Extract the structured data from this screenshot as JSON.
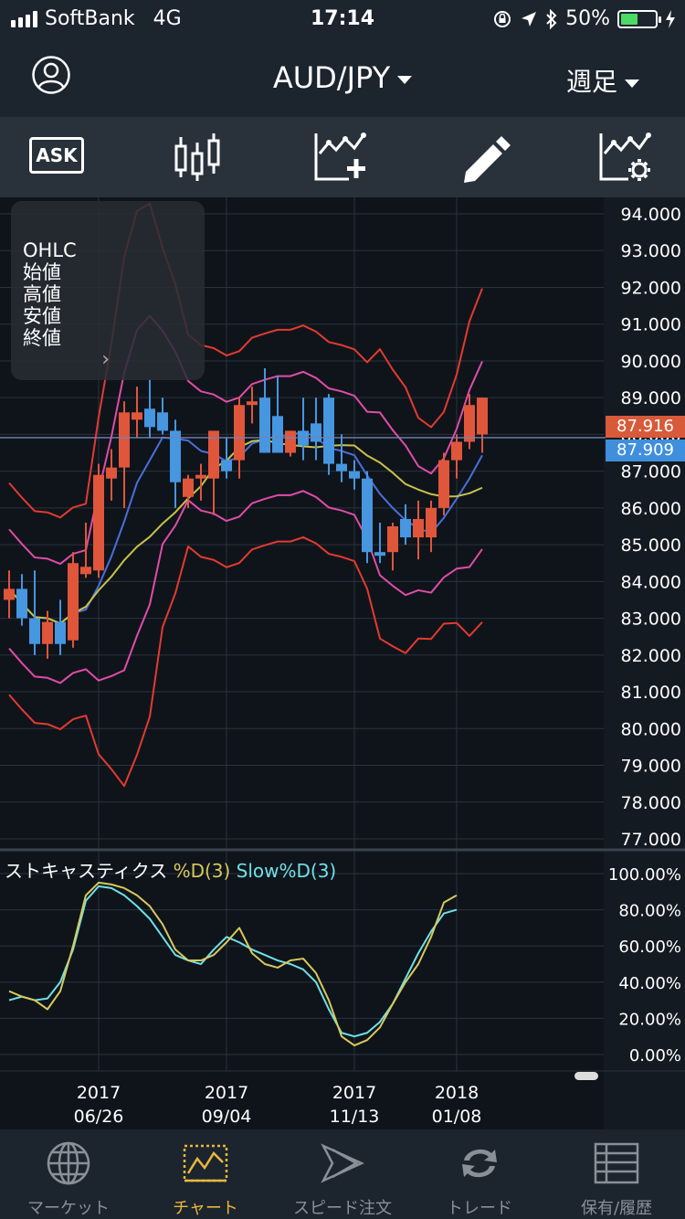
{
  "status_bar": {
    "carrier": "SoftBank",
    "network": "4G",
    "time": "17:14",
    "battery": "50%",
    "battery_level": 0.5
  },
  "nav": {
    "pair": "AUD/JPY",
    "period": "週足"
  },
  "toolbar": {
    "ask_label": "ASK"
  },
  "ohlc_panel": {
    "title": "OHLC",
    "open": "始値",
    "high": "高値",
    "low": "安値",
    "close": "終値"
  },
  "price_tags": {
    "ask": "87.916",
    "bid": "87.909"
  },
  "indicator": {
    "name": "ストキャスティクス",
    "k_label": "%D(3)",
    "slow_label": "Slow%D(3)"
  },
  "colors": {
    "up": "#e0563b",
    "down": "#4696e0",
    "ma_short": "#4a6fdc",
    "ma_long": "#c8c24a",
    "band_inner": "#e04ca8",
    "band_outer": "#e43a2f",
    "k_line": "#d8c95a",
    "slow_line": "#6fe0e8",
    "active_tab": "#e9b83c"
  },
  "chart_data": {
    "type": "candlestick",
    "price_axis": {
      "ticks": [
        "94.000",
        "93.000",
        "92.000",
        "91.000",
        "90.000",
        "89.000",
        "88.000",
        "87.000",
        "86.000",
        "85.000",
        "84.000",
        "83.000",
        "82.000",
        "81.000",
        "80.000",
        "79.000",
        "78.000",
        "77.000"
      ],
      "ylim": [
        77,
        94
      ]
    },
    "osc_axis": {
      "ticks": [
        "100.00%",
        "80.00%",
        "60.00%",
        "40.00%",
        "20.00%",
        "0.00%"
      ],
      "ylim": [
        0,
        100
      ]
    },
    "date_labels": [
      {
        "year": "2017",
        "date": "06/26"
      },
      {
        "year": "2017",
        "date": "09/04"
      },
      {
        "year": "2017",
        "date": "11/13"
      },
      {
        "year": "2018",
        "date": "01/08"
      }
    ],
    "date_label_index": [
      7,
      17,
      27,
      35
    ],
    "candles": [
      [
        83.5,
        84.3,
        83.0,
        83.8
      ],
      [
        83.8,
        84.2,
        82.8,
        83.0
      ],
      [
        83.0,
        84.3,
        82.0,
        82.3
      ],
      [
        82.3,
        83.2,
        81.9,
        82.9
      ],
      [
        82.9,
        83.5,
        82.0,
        82.3
      ],
      [
        82.4,
        84.8,
        82.2,
        84.5
      ],
      [
        84.2,
        85.6,
        84.1,
        84.4
      ],
      [
        84.3,
        87.2,
        84.1,
        86.9
      ],
      [
        86.8,
        87.6,
        86.2,
        87.1
      ],
      [
        87.1,
        88.9,
        86.0,
        88.6
      ],
      [
        88.4,
        89.3,
        87.9,
        88.6
      ],
      [
        88.7,
        89.5,
        87.9,
        88.2
      ],
      [
        88.6,
        89.0,
        88.0,
        88.1
      ],
      [
        88.1,
        88.4,
        86.0,
        86.7
      ],
      [
        86.3,
        86.9,
        86.0,
        86.8
      ],
      [
        86.8,
        87.2,
        86.2,
        86.9
      ],
      [
        86.8,
        88.0,
        85.8,
        88.1
      ],
      [
        87.3,
        87.9,
        86.8,
        87.0
      ],
      [
        87.3,
        89.0,
        86.8,
        88.8
      ],
      [
        88.8,
        89.3,
        88.3,
        88.9
      ],
      [
        89.0,
        89.8,
        87.8,
        87.5
      ],
      [
        88.5,
        89.6,
        87.8,
        87.5
      ],
      [
        87.5,
        88.1,
        87.4,
        88.1
      ],
      [
        88.1,
        89.0,
        87.3,
        87.7
      ],
      [
        88.3,
        89.0,
        87.3,
        87.8
      ],
      [
        89.0,
        89.1,
        86.9,
        87.2
      ],
      [
        87.2,
        88.0,
        86.7,
        87.0
      ],
      [
        87.0,
        87.3,
        86.5,
        86.8
      ],
      [
        86.8,
        87.0,
        84.5,
        84.8
      ],
      [
        84.8,
        85.6,
        84.5,
        84.7
      ],
      [
        84.8,
        85.6,
        84.3,
        85.5
      ],
      [
        85.7,
        86.1,
        85.0,
        85.2
      ],
      [
        85.2,
        86.2,
        84.6,
        85.7
      ],
      [
        85.2,
        86.2,
        84.8,
        86.0
      ],
      [
        86.0,
        87.5,
        85.8,
        87.3
      ],
      [
        87.3,
        88.0,
        86.8,
        87.8
      ],
      [
        87.8,
        89.1,
        87.6,
        88.8
      ],
      [
        88.0,
        89.0,
        87.5,
        89.0
      ]
    ],
    "stoch_k": [
      35,
      32,
      30,
      25,
      35,
      60,
      88,
      95,
      94,
      92,
      88,
      82,
      72,
      58,
      52,
      52,
      55,
      62,
      70,
      56,
      50,
      48,
      52,
      53,
      45,
      30,
      10,
      5,
      8,
      15,
      28,
      40,
      50,
      65,
      84,
      88
    ],
    "stoch_slow": [
      30,
      32,
      30,
      31,
      40,
      58,
      85,
      93,
      92,
      88,
      82,
      75,
      65,
      55,
      52,
      50,
      58,
      65,
      62,
      58,
      55,
      52,
      50,
      47,
      40,
      25,
      12,
      10,
      12,
      18,
      28,
      42,
      56,
      68,
      78,
      80
    ]
  },
  "tabs": [
    {
      "label": "マーケット",
      "icon": "globe-icon"
    },
    {
      "label": "チャート",
      "icon": "chart-icon"
    },
    {
      "label": "スピード注文",
      "icon": "speed-order-icon"
    },
    {
      "label": "トレード",
      "icon": "trade-icon"
    },
    {
      "label": "保有/履歴",
      "icon": "holdings-icon"
    }
  ]
}
